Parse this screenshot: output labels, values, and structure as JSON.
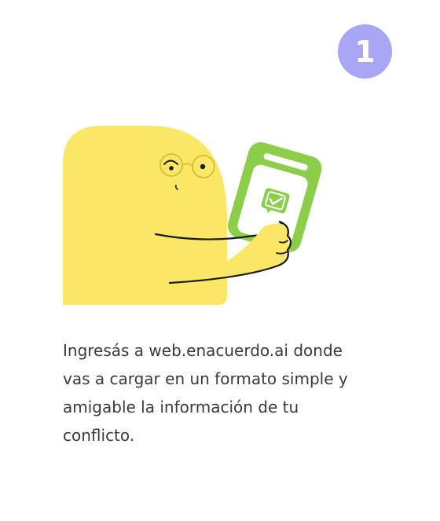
{
  "step": {
    "number": "1"
  },
  "illustration": {
    "character_color": "#fae765",
    "phone_color": "#8cce4a",
    "badge_color": "#a9a6f5",
    "icon": "chat-check-icon"
  },
  "description": {
    "text": "Ingresás a web.enacuerdo.ai donde\nvas a cargar en un formato  simple y\namigable la información de tu\nconflicto."
  }
}
